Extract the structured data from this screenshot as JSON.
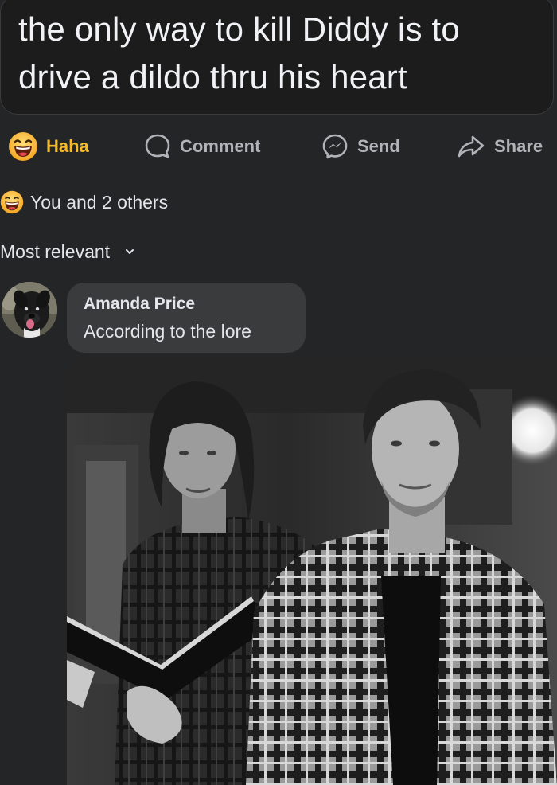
{
  "post": {
    "text_line1": "the only way to kill Diddy is to",
    "text_line2": "drive a dildo thru his heart"
  },
  "actions": {
    "haha": {
      "label": "Haha",
      "icon": "haha-emoji-icon",
      "color": "#f7b928"
    },
    "comment": {
      "label": "Comment",
      "icon": "comment-icon"
    },
    "send": {
      "label": "Send",
      "icon": "messenger-icon"
    },
    "share": {
      "label": "Share",
      "icon": "share-icon"
    }
  },
  "reactions": {
    "summary": "You and 2 others",
    "icon": "haha-emoji-icon"
  },
  "comments_sort": {
    "label": "Most relevant",
    "icon": "chevron-down-icon"
  },
  "comment": {
    "author": "Amanda Price",
    "text": "According to the lore",
    "avatar": "dog-avatar",
    "attachment": "black-and-white photo of two men, one holding an open book"
  },
  "colors": {
    "background": "#242526",
    "bubble": "#3a3b3c",
    "text": "#e4e6eb",
    "secondary_text": "#b0b3b8",
    "haha": "#f7b928"
  }
}
